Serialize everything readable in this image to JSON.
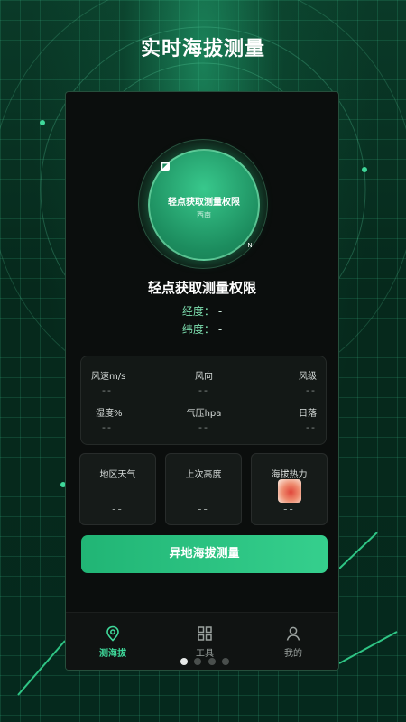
{
  "header": {
    "title": "实时海拔测量"
  },
  "compass": {
    "title": "轻点获取测量权限",
    "direction": "西南",
    "n_mark": "N"
  },
  "status": {
    "title": "轻点获取测量权限",
    "longitude_label": "经度：",
    "longitude_value": "-",
    "latitude_label": "纬度：",
    "latitude_value": "-"
  },
  "weather": {
    "items": [
      {
        "label": "风速m/s",
        "value": "--"
      },
      {
        "label": "风向",
        "value": "--"
      },
      {
        "label": "风级",
        "value": "--"
      },
      {
        "label": "湿度%",
        "value": "--"
      },
      {
        "label": "气压hpa",
        "value": "--"
      },
      {
        "label": "日落",
        "value": "--"
      }
    ]
  },
  "cards": [
    {
      "title": "地区天气",
      "value": "--"
    },
    {
      "title": "上次高度",
      "value": "--"
    },
    {
      "title": "海拔热力",
      "value": "--"
    }
  ],
  "action": {
    "label": "异地海拔测量"
  },
  "tabs": [
    {
      "label": "测海拔",
      "icon": "location-pin-icon",
      "active": true
    },
    {
      "label": "工具",
      "icon": "grid-icon",
      "active": false
    },
    {
      "label": "我的",
      "icon": "user-icon",
      "active": false
    }
  ],
  "pager": {
    "count": 4,
    "active_index": 0
  },
  "colors": {
    "accent": "#2fc585",
    "background": "#06251a",
    "panel": "#0b0e0d"
  }
}
